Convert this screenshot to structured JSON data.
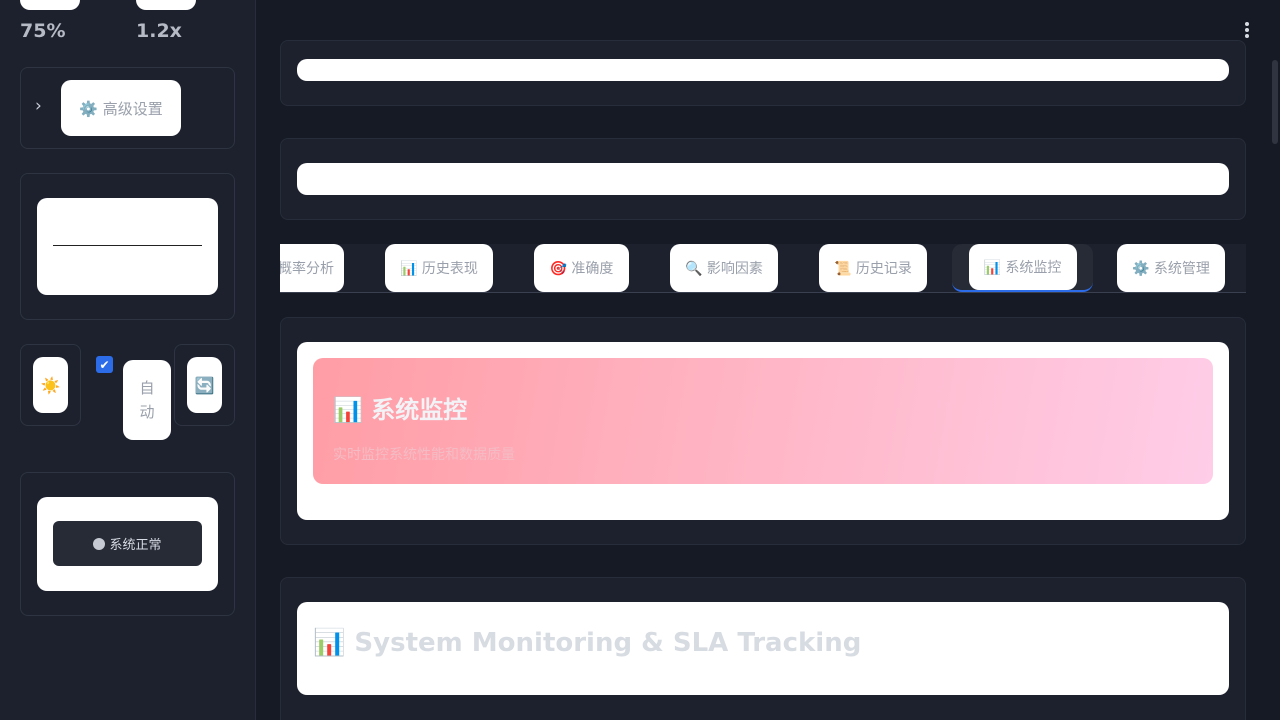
{
  "sidebar": {
    "metric_left": "75%",
    "metric_right": "1.2x",
    "advanced_settings": {
      "icon": "gear-icon",
      "label": "⚙️ 高级设置"
    },
    "theme_icon": "☀️",
    "auto_checkbox_checked": true,
    "auto_label": "自动",
    "refresh_icon": "🔄",
    "status": {
      "label": "系统正常",
      "dot_color": "#c6cad2"
    }
  },
  "tabs": [
    {
      "label": "概率分析",
      "icon": "",
      "active": false
    },
    {
      "label": "📊 历史表现",
      "icon": "bar-chart-icon",
      "active": false
    },
    {
      "label": "🎯 准确度",
      "icon": "target-icon",
      "active": false
    },
    {
      "label": "🔍 影响因素",
      "icon": "magnifier-icon",
      "active": false
    },
    {
      "label": "📜 历史记录",
      "icon": "scroll-icon",
      "active": false
    },
    {
      "label": "📊 系统监控",
      "icon": "bar-chart-icon",
      "active": true
    },
    {
      "label": "⚙️ 系统管理",
      "icon": "gear-icon",
      "active": false
    }
  ],
  "hero": {
    "title": "📊 系统监控",
    "subtitle": "实时监控系统性能和数据质量"
  },
  "sla": {
    "title": "📊 System Monitoring & SLA Tracking"
  },
  "colors": {
    "accent": "#2d6ce8",
    "background": "#151a24",
    "panel": "#1c212d"
  }
}
